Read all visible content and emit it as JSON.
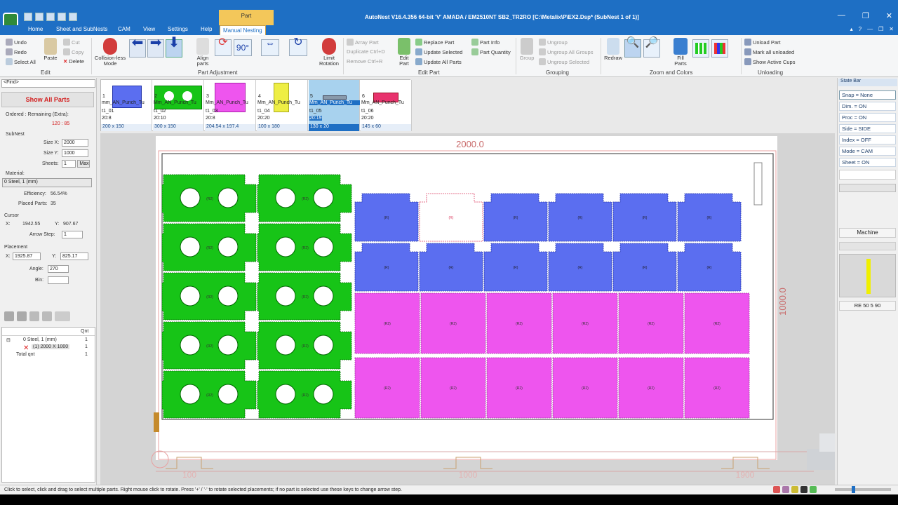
{
  "window": {
    "title": "AutoNest V16.4.356 64-bit  'V'  AMADA / EM2510NT  SB2_TR2RO    [C:\\Metalix\\P\\EX2.Dsp* (SubNest 1 of 1)]",
    "context_tab": "Part",
    "controls": [
      "—",
      "❐",
      "✕"
    ]
  },
  "menu": {
    "tabs": [
      "Home",
      "Sheet and SubNests",
      "CAM",
      "View",
      "Settings",
      "Help",
      "Manual Nesting"
    ],
    "active": "Manual Nesting",
    "right_controls": [
      "▴",
      "?",
      "—",
      "❐",
      "✕"
    ]
  },
  "ribbon": {
    "edit": {
      "label": "Edit",
      "undo": "Undo",
      "redo": "Redo",
      "select_all": "Select All",
      "paste": "Paste",
      "cut": "Cut",
      "copy": "Copy",
      "delete": "Delete"
    },
    "part_adjustment": {
      "label": "Part Adjustment",
      "collisionless": "Collision-less\nMode",
      "align": "Align\nparts",
      "rot90": "90°",
      "limit_rotation": "Limit\nRotation"
    },
    "edit_part": {
      "label": "Edit Part",
      "array_part": "Array Part",
      "duplicate": "Duplicate Ctrl+D",
      "remove": "Remove Ctrl+R",
      "edit_part_btn": "Edit\nPart",
      "replace_part": "Replace Part",
      "update_selected": "Update Selected",
      "update_all": "Update All Parts",
      "part_info": "Part Info",
      "part_quantity": "Part Quantity"
    },
    "grouping": {
      "label": "Grouping",
      "group": "Group",
      "ungroup": "Ungroup",
      "ungroup_all": "Ungroup All Groups",
      "ungroup_selected": "Ungroup Selected"
    },
    "zoom": {
      "label": "Zoom and Colors",
      "redraw": "Redraw",
      "fill_parts": "Fill\nParts"
    },
    "unloading": {
      "label": "Unloading",
      "unload_part": "Unload Part",
      "mark_all": "Mark all unloaded",
      "show_cups": "Show Active Cups"
    }
  },
  "left_panel": {
    "find_placeholder": "<Find>",
    "show_all": "Show All Parts",
    "ordered_label": "Ordered : Remaining (Extra):",
    "ordered_value": "120 : 85",
    "subnest_label": "SubNest",
    "size_x_label": "Size X:",
    "size_x": "2000",
    "size_y_label": "Size Y:",
    "size_y": "1000",
    "sheets_label": "Sheets:",
    "sheets": "1",
    "max_btn": "Max",
    "material_label": "Material:",
    "material_value": "0  Steel, 1 (mm)",
    "efficiency_label": "Efficiency:",
    "efficiency": "56.54%",
    "placed_label": "Placed Parts:",
    "placed": "35",
    "cursor_label": "Cursor",
    "cursor_x_label": "X:",
    "cursor_x": "1942.55",
    "cursor_y_label": "Y:",
    "cursor_y": "907.67",
    "arrow_step_label": "Arrow Step:",
    "arrow_step": "1",
    "placement_label": "Placement",
    "place_x_label": "X:",
    "place_x": "1925.87",
    "place_y_label": "Y:",
    "place_y": "825.17",
    "angle_label": "Angle:",
    "angle": "270",
    "bin_label": "Bin:",
    "bin": "",
    "tree_header_qnt": "Qnt",
    "tree_rows": [
      {
        "label": "0  Steel, 1 (mm)",
        "qnt": "1"
      },
      {
        "label": "(1) 2000 X 1000",
        "qnt": "1"
      },
      {
        "label": "Total qnt",
        "qnt": "1"
      }
    ]
  },
  "thumbnails": [
    {
      "num": "1",
      "name": "mm_AN_Punch_Tu",
      "name2": "t1_01",
      "ratio": "20:8",
      "size": "200 x 150",
      "color": "#5b6ef0"
    },
    {
      "num": "2",
      "name": "Mm_AN_Punch_Tu",
      "name2": "t1_02",
      "ratio": "20:10",
      "size": "300 x 150",
      "color": "#17c417"
    },
    {
      "num": "3",
      "name": "Mm_AN_Punch_Tu",
      "name2": "t1_03",
      "ratio": "20:8",
      "size": "204.54 x 197.4",
      "color": "#ee55ee"
    },
    {
      "num": "4",
      "name": "Mm_AN_Punch_Tu",
      "name2": "t1_04",
      "ratio": "20:20",
      "size": "100 x 180",
      "color": "#eeee44"
    },
    {
      "num": "5",
      "name": "Mm_AN_Punch_Tu",
      "name2": "t1_05",
      "ratio": "20:19",
      "size": "130 x 20",
      "color": "#8899aa"
    },
    {
      "num": "6",
      "name": "Mm_AN_Punch_Tu",
      "name2": "t1_06",
      "ratio": "20:20",
      "size": "145 x 60",
      "color": "#e8336d"
    }
  ],
  "nest": {
    "dim_x": "2000.0",
    "dim_y": "1000.0",
    "ruler": [
      "100",
      "1000",
      "1900"
    ],
    "part_label_green": "(R2)",
    "part_label_blue": "(R)",
    "part_label_pink": "(R2)"
  },
  "state_bar": {
    "title": "State Bar",
    "items": [
      "Snap = None",
      "Dim. = ON",
      "Proc = ON",
      "Side = SIDE",
      "Index = OFF",
      "Mode = CAM",
      "Sheet = ON"
    ],
    "machine": "Machine",
    "tool": "RE 50 5 90"
  },
  "status": "Click to select, click and drag to select multiple parts. Right mouse click to rotate. Press '+' / '-' to rotate selected placements; if no part is selected use these keys to change arrow step.",
  "colors": {
    "titlebar": "#1e6fc4",
    "green": "#17c417",
    "blue": "#5b6ef0",
    "pink": "#ee55ee"
  }
}
